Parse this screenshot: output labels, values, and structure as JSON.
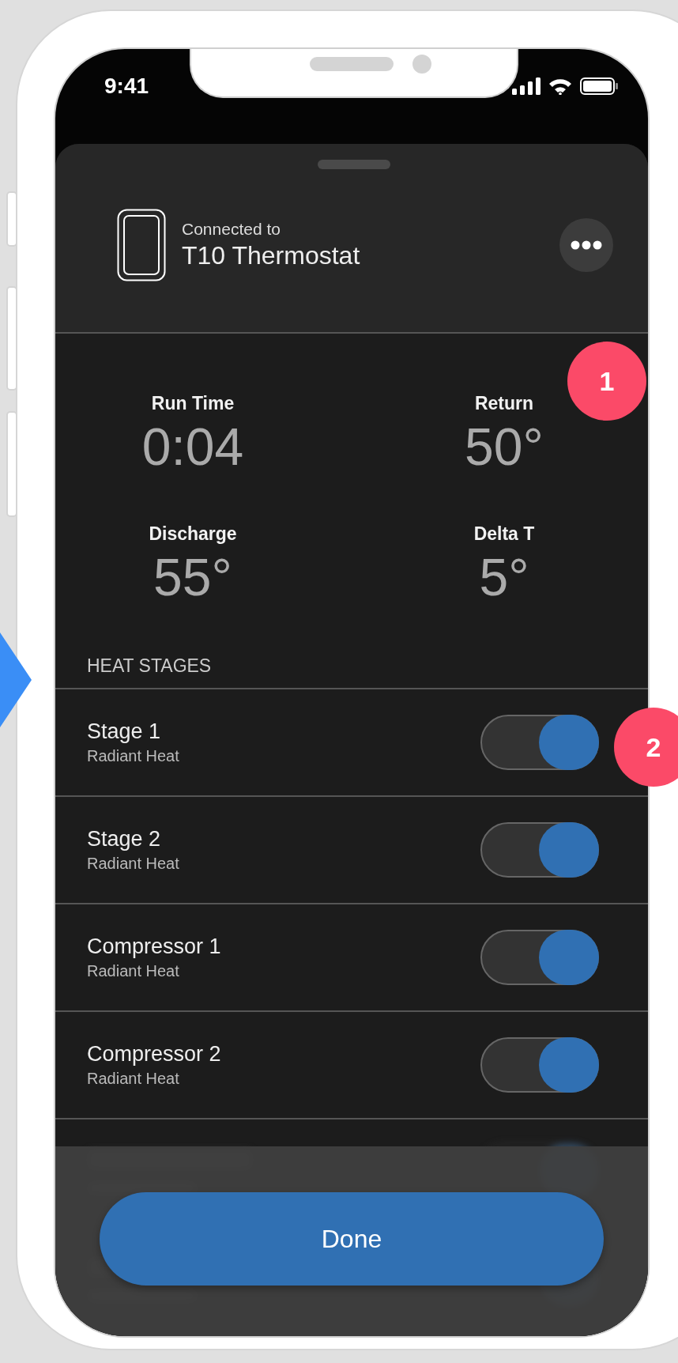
{
  "status_bar": {
    "time": "9:41"
  },
  "header": {
    "caption": "Connected to",
    "device": "T10 Thermostat"
  },
  "stats": [
    {
      "label": "Run Time",
      "value": "0:04"
    },
    {
      "label": "Return",
      "value": "50°"
    },
    {
      "label": "Discharge",
      "value": "55°"
    },
    {
      "label": "Delta T",
      "value": "5°"
    }
  ],
  "section_title": "HEAT STAGES",
  "stages": [
    {
      "name": "Stage 1",
      "subtitle": "Radiant Heat",
      "on": true
    },
    {
      "name": "Stage 2",
      "subtitle": "Radiant Heat",
      "on": true
    },
    {
      "name": "Compressor 1",
      "subtitle": "Radiant Heat",
      "on": true
    },
    {
      "name": "Compressor 2",
      "subtitle": "Radiant Heat",
      "on": true
    }
  ],
  "done_button": "Done",
  "annotations": [
    {
      "label": "1"
    },
    {
      "label": "2"
    }
  ]
}
